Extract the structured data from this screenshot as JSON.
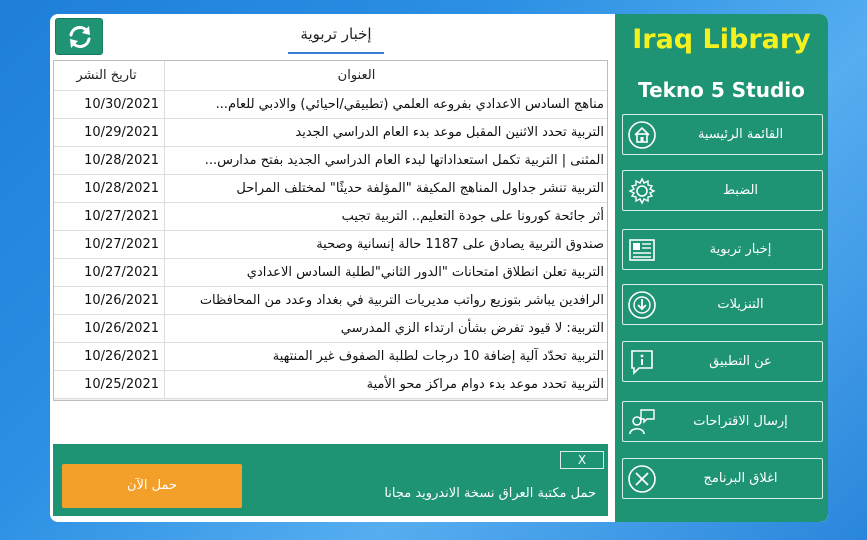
{
  "sidebar": {
    "title": "Iraq Library",
    "subtitle": "Tekno 5 Studio",
    "items": [
      {
        "label": "القائمة الرئيسية",
        "icon": "home-icon"
      },
      {
        "label": "الضبط",
        "icon": "gear-icon"
      },
      {
        "label": "إخبار تربوية",
        "icon": "newspaper-icon"
      },
      {
        "label": "التنزيلات",
        "icon": "download-icon"
      },
      {
        "label": "عن التطبيق",
        "icon": "info-icon"
      },
      {
        "label": "إرسال الاقتراحات",
        "icon": "feedback-icon"
      },
      {
        "label": "اغلاق البرنامج",
        "icon": "close-circle-icon"
      }
    ]
  },
  "main": {
    "refresh_icon": "refresh-icon",
    "tab_title": "إخبار تربوية",
    "table": {
      "columns": {
        "title": "العنوان",
        "date": "تاريخ النشر"
      },
      "rows": [
        {
          "title": "مناهج السادس الاعدادي بفروعه العلمي (تطبيقي/احيائي) والادبي للعام...",
          "date": "10/30/2021"
        },
        {
          "title": "التربية تحدد الاثنين المقبل موعد بدء العام الدراسي الجديد",
          "date": "10/29/2021"
        },
        {
          "title": "المثنى | التربية تكمل استعداداتها لبدء العام الدراسي الجديد بفتح مدارس...",
          "date": "10/28/2021"
        },
        {
          "title": "التربية تنشر جداول المناهج المكيفة \"المؤلفة حديثًا\" لمختلف المراحل",
          "date": "10/28/2021"
        },
        {
          "title": "أثر جائحة كورونا على جودة التعليم.. التربية تجيب",
          "date": "10/27/2021"
        },
        {
          "title": "صندوق التربية يصادق على 1187 حالة إنسانية وصحية",
          "date": "10/27/2021"
        },
        {
          "title": "التربية تعلن انطلاق امتحانات \"الدور الثاني\"لطلبة السادس الاعدادي",
          "date": "10/27/2021"
        },
        {
          "title": "الرافدين يباشر بتوزيع رواتب مديريات التربية في بغداد وعدد من المحافظات",
          "date": "10/26/2021"
        },
        {
          "title": "التربية: لا قيود تفرض بشأن ارتداء الزي المدرسي",
          "date": "10/26/2021"
        },
        {
          "title": "التربية تحدّد آلية إضافة 10 درجات لطلبة الصفوف غير المنتهية",
          "date": "10/26/2021"
        },
        {
          "title": "التربية تحدد موعد بدء دوام مراكز محو الأمية",
          "date": "10/25/2021"
        }
      ]
    }
  },
  "banner": {
    "download_label": "حمل الآن",
    "text": "حمل مكتبة العراق نسخة الاندرويد مجانا",
    "close_label": "X"
  }
}
